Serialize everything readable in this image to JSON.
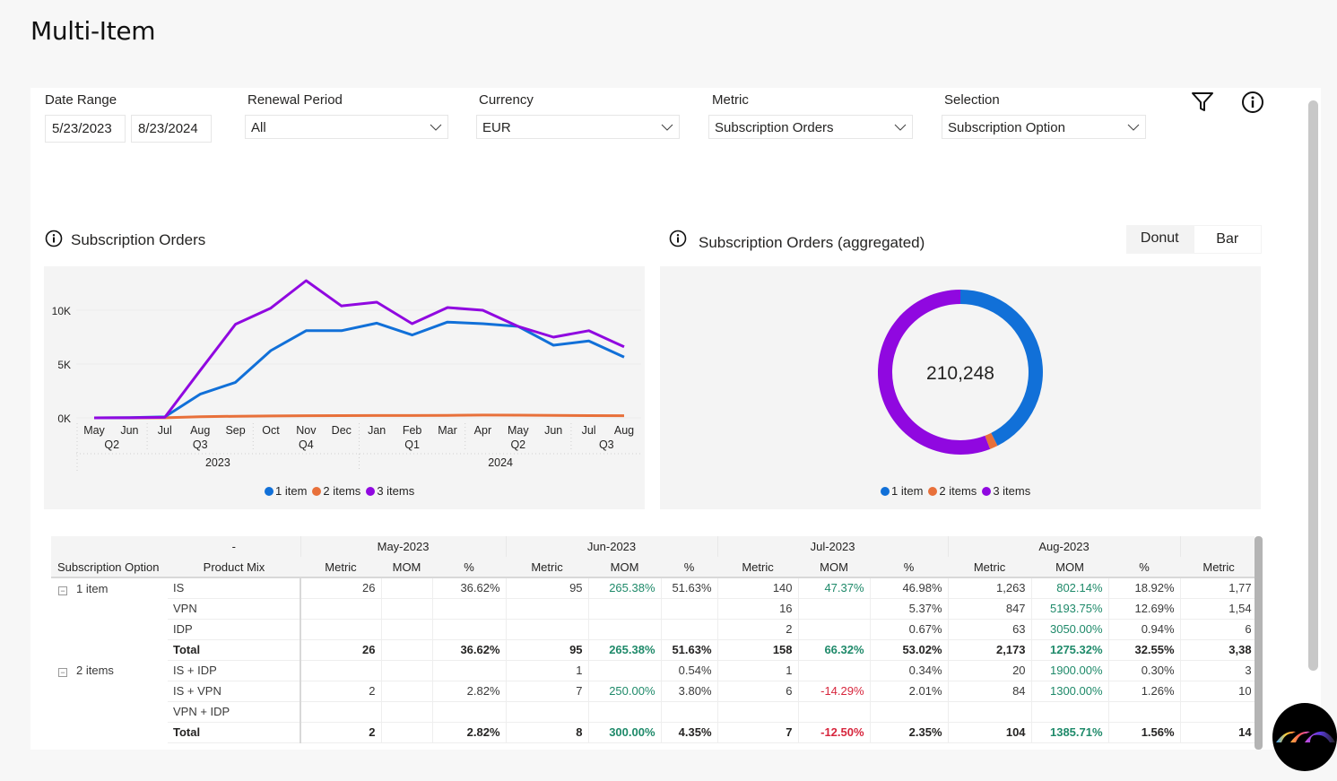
{
  "page": {
    "title": "Multi-Item"
  },
  "filters": {
    "date_range": {
      "label": "Date Range",
      "start": "5/23/2023",
      "end": "8/23/2024"
    },
    "renewal_period": {
      "label": "Renewal Period",
      "value": "All"
    },
    "currency": {
      "label": "Currency",
      "value": "EUR"
    },
    "metric": {
      "label": "Metric",
      "value": "Subscription Orders"
    },
    "selection": {
      "label": "Selection",
      "value": "Subscription Option"
    }
  },
  "icons": {
    "filter": "filter-icon",
    "info": "info-icon",
    "chevron": "chevron-down-icon",
    "assistant": "assistant-logo-icon"
  },
  "line_section": {
    "title": "Subscription Orders"
  },
  "donut_section": {
    "title": "Subscription Orders (aggregated)",
    "toggle": [
      "Donut",
      "Bar"
    ],
    "toggle_active": "Donut"
  },
  "colors": {
    "1 item": "#1170d8",
    "2 items": "#e8703a",
    "3 items": "#9008e0",
    "positive": "#1f8a6a",
    "negative": "#d7263d"
  },
  "chart_data": [
    {
      "type": "line",
      "title": "Subscription Orders",
      "x": [
        "May",
        "Jun",
        "Jul",
        "Aug",
        "Sep",
        "Oct",
        "Nov",
        "Dec",
        "Jan",
        "Feb",
        "Mar",
        "Apr",
        "May",
        "Jun",
        "Jul",
        "Aug"
      ],
      "quarters": [
        {
          "label": "Q2",
          "span": 2
        },
        {
          "label": "Q3",
          "span": 3
        },
        {
          "label": "Q4",
          "span": 3
        },
        {
          "label": "Q1",
          "span": 3
        },
        {
          "label": "Q2",
          "span": 3
        },
        {
          "label": "Q3",
          "span": 2
        }
      ],
      "years": [
        {
          "label": "2023",
          "span": 8
        },
        {
          "label": "2024",
          "span": 8
        }
      ],
      "yticks": [
        0,
        5000,
        10000
      ],
      "ytick_labels": [
        "0K",
        "5K",
        "10K"
      ],
      "ylim": [
        0,
        13000
      ],
      "grid": true,
      "legend_position": "bottom-center",
      "series": [
        {
          "name": "1 item",
          "values": [
            0,
            20,
            95,
            2200,
            3300,
            6250,
            8100,
            8100,
            8800,
            7700,
            8900,
            8750,
            8500,
            6750,
            7150,
            5650
          ]
        },
        {
          "name": "2 items",
          "values": [
            0,
            5,
            8,
            104,
            150,
            180,
            200,
            210,
            220,
            220,
            230,
            260,
            250,
            230,
            210,
            200
          ]
        },
        {
          "name": "3 items",
          "values": [
            0,
            10,
            50,
            4400,
            8700,
            10200,
            12750,
            10400,
            10750,
            8750,
            10250,
            10000,
            8500,
            7500,
            8100,
            6600
          ]
        }
      ]
    },
    {
      "type": "pie",
      "title": "Subscription Orders (aggregated)",
      "center_label": "210,248",
      "legend_position": "bottom-center",
      "categories": [
        "1 item",
        "2 items",
        "3 items"
      ],
      "values": [
        89500,
        3300,
        117448
      ]
    }
  ],
  "table": {
    "group_header_blank": "-",
    "row_headers": [
      "Subscription Option",
      "Product Mix"
    ],
    "months": [
      "May-2023",
      "Jun-2023",
      "Jul-2023",
      "Aug-2023",
      ""
    ],
    "subcolumns": [
      "Metric",
      "MOM",
      "%"
    ],
    "groups": [
      {
        "option": "1 item",
        "rows": [
          {
            "mix": "IS",
            "bold": false,
            "cells": [
              [
                "26",
                "",
                "36.62%"
              ],
              [
                "95",
                "265.38%",
                "51.63%"
              ],
              [
                "140",
                "47.37%",
                "46.98%"
              ],
              [
                "1,263",
                "802.14%",
                "18.92%"
              ],
              [
                "1,77"
              ]
            ]
          },
          {
            "mix": "VPN",
            "bold": false,
            "cells": [
              [
                "",
                "",
                ""
              ],
              [
                "",
                "",
                ""
              ],
              [
                "16",
                "",
                "5.37%"
              ],
              [
                "847",
                "5193.75%",
                "12.69%"
              ],
              [
                "1,54"
              ]
            ]
          },
          {
            "mix": "IDP",
            "bold": false,
            "cells": [
              [
                "",
                "",
                ""
              ],
              [
                "",
                "",
                ""
              ],
              [
                "2",
                "",
                "0.67%"
              ],
              [
                "63",
                "3050.00%",
                "0.94%"
              ],
              [
                "6"
              ]
            ]
          },
          {
            "mix": "Total",
            "bold": true,
            "cells": [
              [
                "26",
                "",
                "36.62%"
              ],
              [
                "95",
                "265.38%",
                "51.63%"
              ],
              [
                "158",
                "66.32%",
                "53.02%"
              ],
              [
                "2,173",
                "1275.32%",
                "32.55%"
              ],
              [
                "3,38"
              ]
            ]
          }
        ]
      },
      {
        "option": "2 items",
        "rows": [
          {
            "mix": "IS + IDP",
            "bold": false,
            "cells": [
              [
                "",
                "",
                ""
              ],
              [
                "1",
                "",
                "0.54%"
              ],
              [
                "1",
                "",
                "0.34%"
              ],
              [
                "20",
                "1900.00%",
                "0.30%"
              ],
              [
                "3"
              ]
            ]
          },
          {
            "mix": "IS + VPN",
            "bold": false,
            "cells": [
              [
                "2",
                "",
                "2.82%"
              ],
              [
                "7",
                "250.00%",
                "3.80%"
              ],
              [
                "6",
                "-14.29%",
                "2.01%"
              ],
              [
                "84",
                "1300.00%",
                "1.26%"
              ],
              [
                "10"
              ]
            ]
          },
          {
            "mix": "VPN + IDP",
            "bold": false,
            "cells": [
              [
                "",
                "",
                ""
              ],
              [
                "",
                "",
                ""
              ],
              [
                "",
                "",
                ""
              ],
              [
                "",
                "",
                ""
              ],
              [
                ""
              ]
            ]
          },
          {
            "mix": "Total",
            "bold": true,
            "cells": [
              [
                "2",
                "",
                "2.82%"
              ],
              [
                "8",
                "300.00%",
                "4.35%"
              ],
              [
                "7",
                "-12.50%",
                "2.35%"
              ],
              [
                "104",
                "1385.71%",
                "1.56%"
              ],
              [
                "14"
              ]
            ]
          }
        ]
      }
    ]
  }
}
